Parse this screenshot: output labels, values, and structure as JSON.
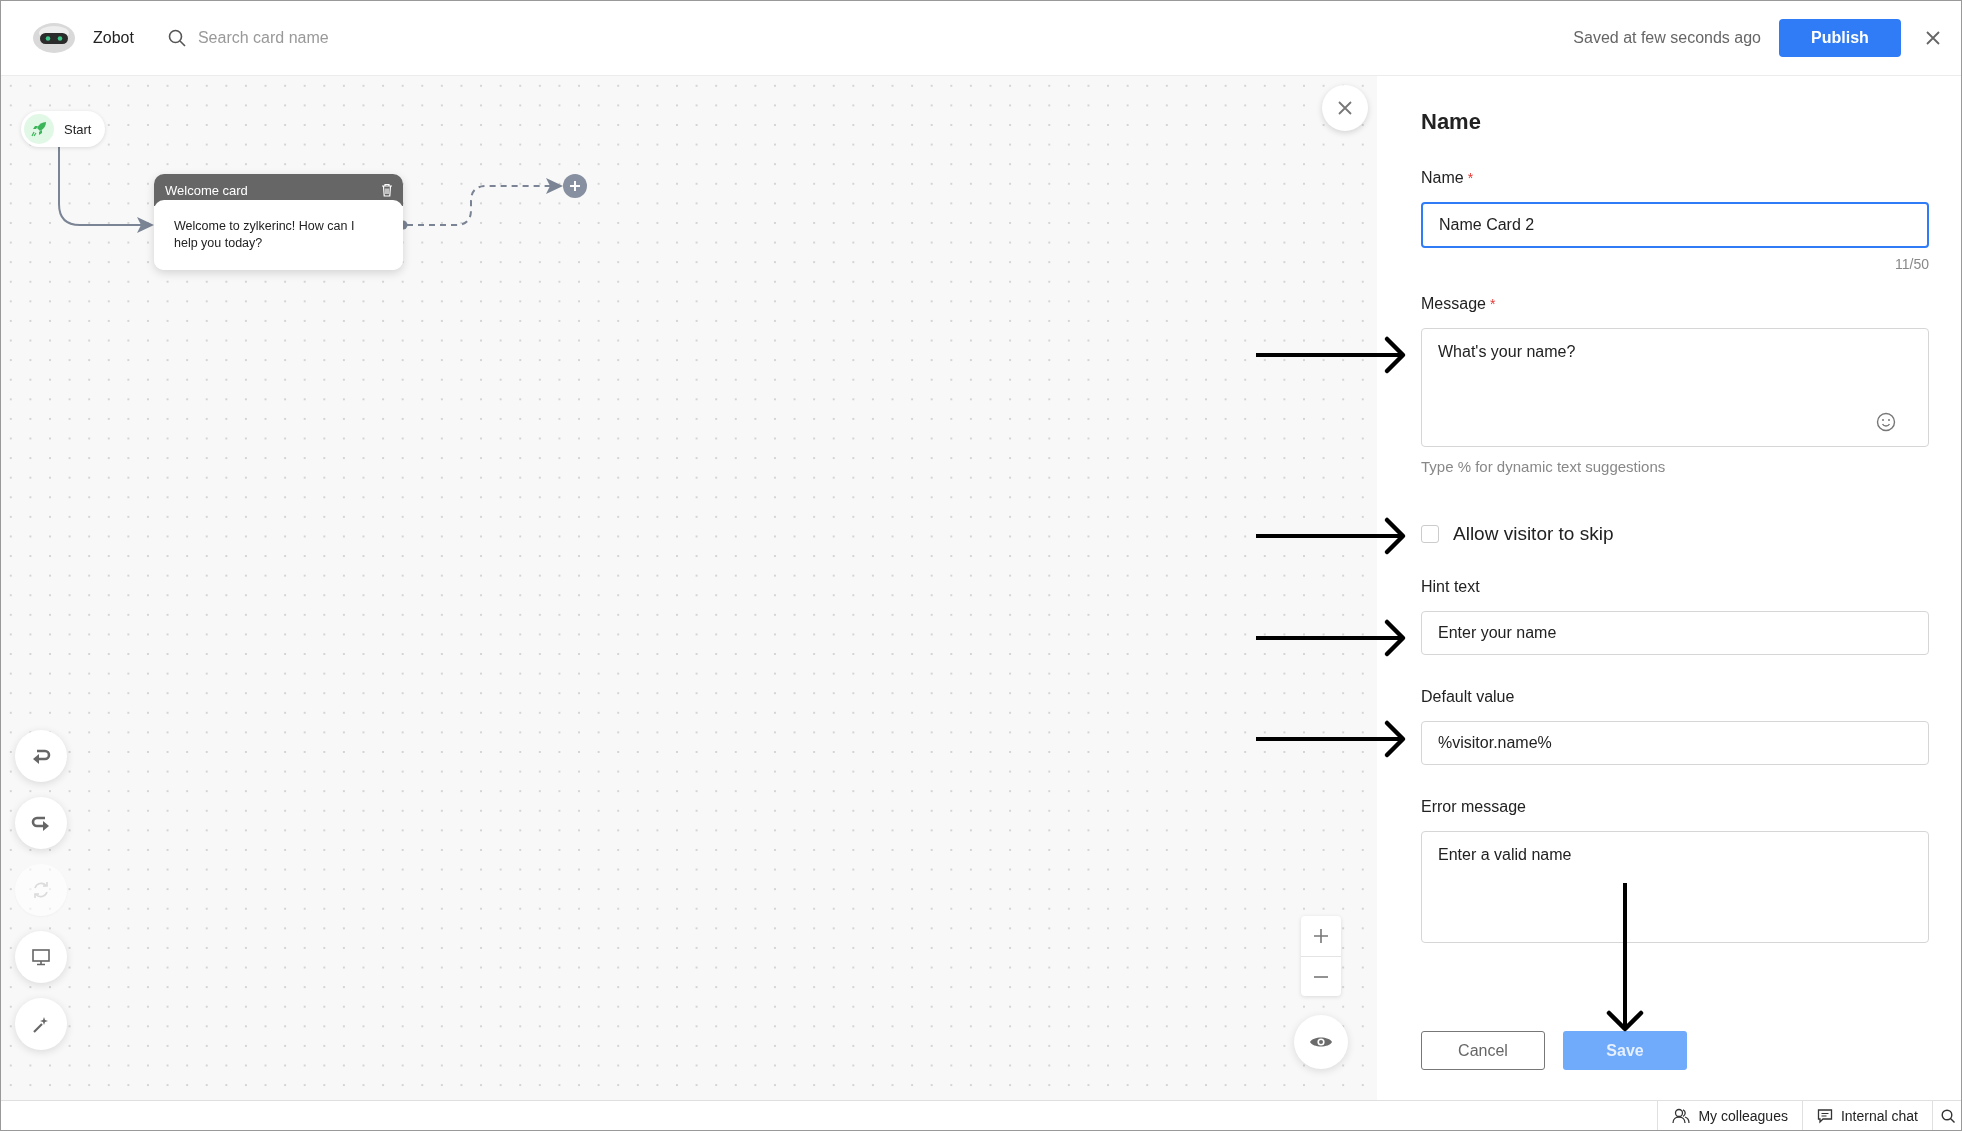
{
  "header": {
    "app_name": "Zobot",
    "search": {
      "placeholder": "Search card name"
    },
    "save_status": "Saved at few seconds ago",
    "publish_button": "Publish"
  },
  "canvas": {
    "start_node": {
      "label": "Start"
    },
    "cards": [
      {
        "title": "Welcome card",
        "message": "Welcome to zylkerinc! How can I help you today?"
      }
    ],
    "tools": [
      {
        "kind": "undo",
        "disabled": false
      },
      {
        "kind": "redo",
        "disabled": false
      },
      {
        "kind": "refresh",
        "disabled": true
      },
      {
        "kind": "preview",
        "disabled": false
      },
      {
        "kind": "magic",
        "disabled": false
      }
    ]
  },
  "panel": {
    "title": "Name",
    "fields": [
      {
        "kind": "input",
        "label": "Name",
        "required_mark": "*",
        "focused": true,
        "value": "Name Card 2",
        "counter": "11/50"
      },
      {
        "kind": "textarea",
        "label": "Message",
        "required_mark": "*",
        "focused": false,
        "value": "What's your name?",
        "hint": "Type % for dynamic text suggestions"
      },
      {
        "kind": "checkbox",
        "label": "Allow visitor to skip",
        "checked": false
      },
      {
        "kind": "input",
        "label": "Hint text",
        "focused": false,
        "value": "Enter your name"
      },
      {
        "kind": "input",
        "label": "Default value",
        "focused": false,
        "value": "%visitor.name%"
      },
      {
        "kind": "textarea",
        "label": "Error message",
        "focused": false,
        "value": "Enter a valid name"
      }
    ],
    "buttons": [
      {
        "label": "Cancel",
        "kind": "secondary",
        "disabled": false
      },
      {
        "label": "Save",
        "kind": "primary",
        "disabled": true
      }
    ]
  },
  "status_bar": {
    "items": [
      {
        "kind": "colleagues",
        "label": "My colleagues"
      },
      {
        "kind": "chat",
        "label": "Internal chat"
      }
    ]
  }
}
